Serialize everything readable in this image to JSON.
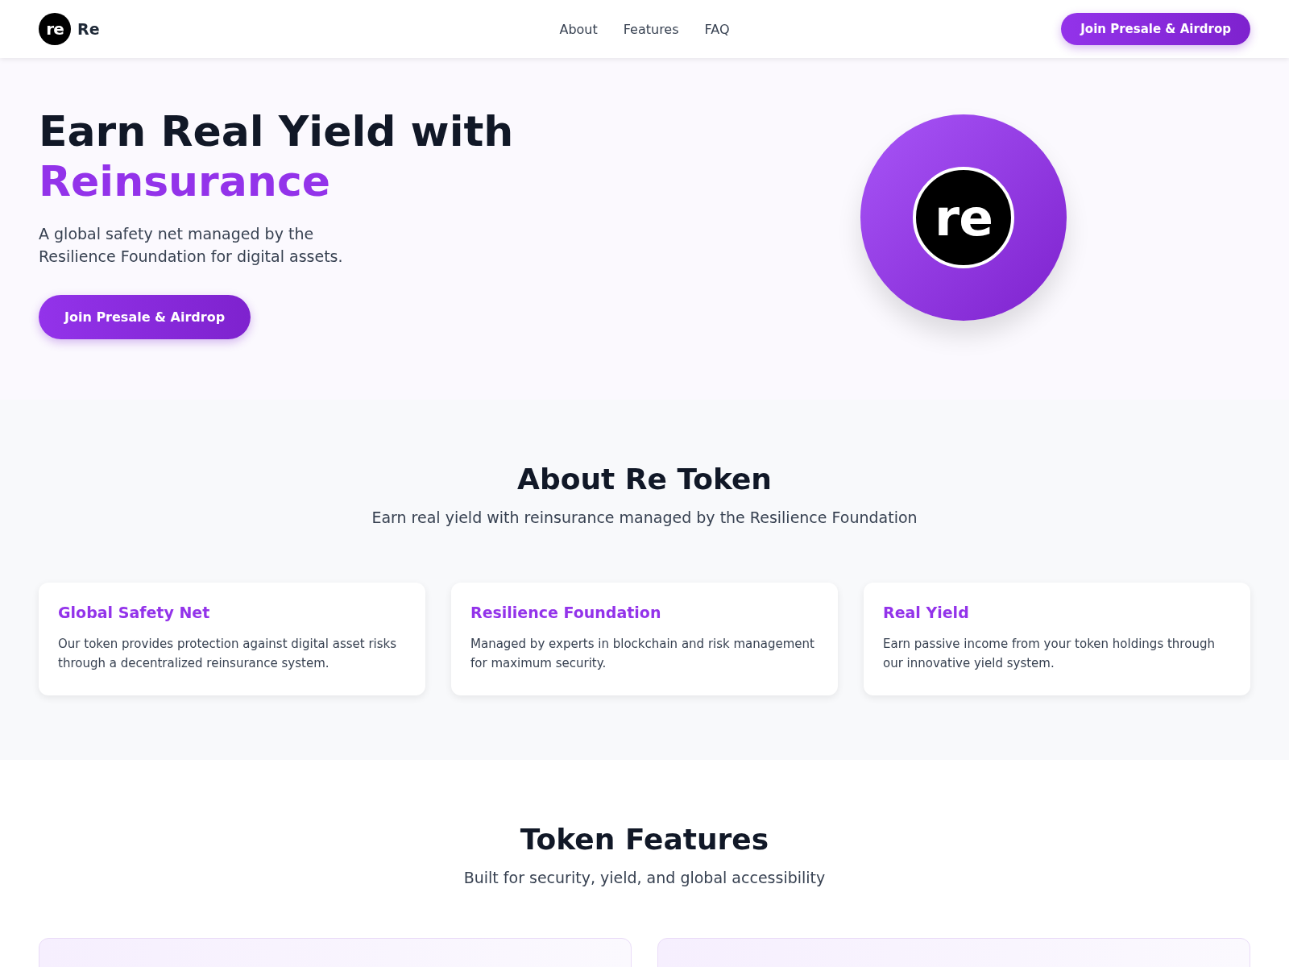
{
  "navbar": {
    "logo_mark": "re",
    "brand": "Re",
    "links": [
      {
        "label": "About"
      },
      {
        "label": "Features"
      },
      {
        "label": "FAQ"
      }
    ],
    "cta": "Join Presale & Airdrop"
  },
  "hero": {
    "title_line_1": "Earn Real Yield with",
    "title_line_2": "Reinsurance",
    "subtitle": "A global safety net managed by the Resilience Foundation for digital assets.",
    "cta": "Join Presale & Airdrop",
    "emblem_mark": "re"
  },
  "about": {
    "title": "About Re Token",
    "subtitle": "Earn real yield with reinsurance managed by the Resilience Foundation",
    "cards": [
      {
        "title": "Global Safety Net",
        "text": "Our token provides protection against digital asset risks through a decentralized reinsurance system."
      },
      {
        "title": "Resilience Foundation",
        "text": "Managed by experts in blockchain and risk management for maximum security."
      },
      {
        "title": "Real Yield",
        "text": "Earn passive income from your token holdings through our innovative yield system."
      }
    ]
  },
  "features": {
    "title": "Token Features",
    "subtitle": "Built for security, yield, and global accessibility",
    "cards": [
      {
        "kind": "cut_off"
      },
      {
        "kind": "cut_off"
      }
    ]
  }
}
